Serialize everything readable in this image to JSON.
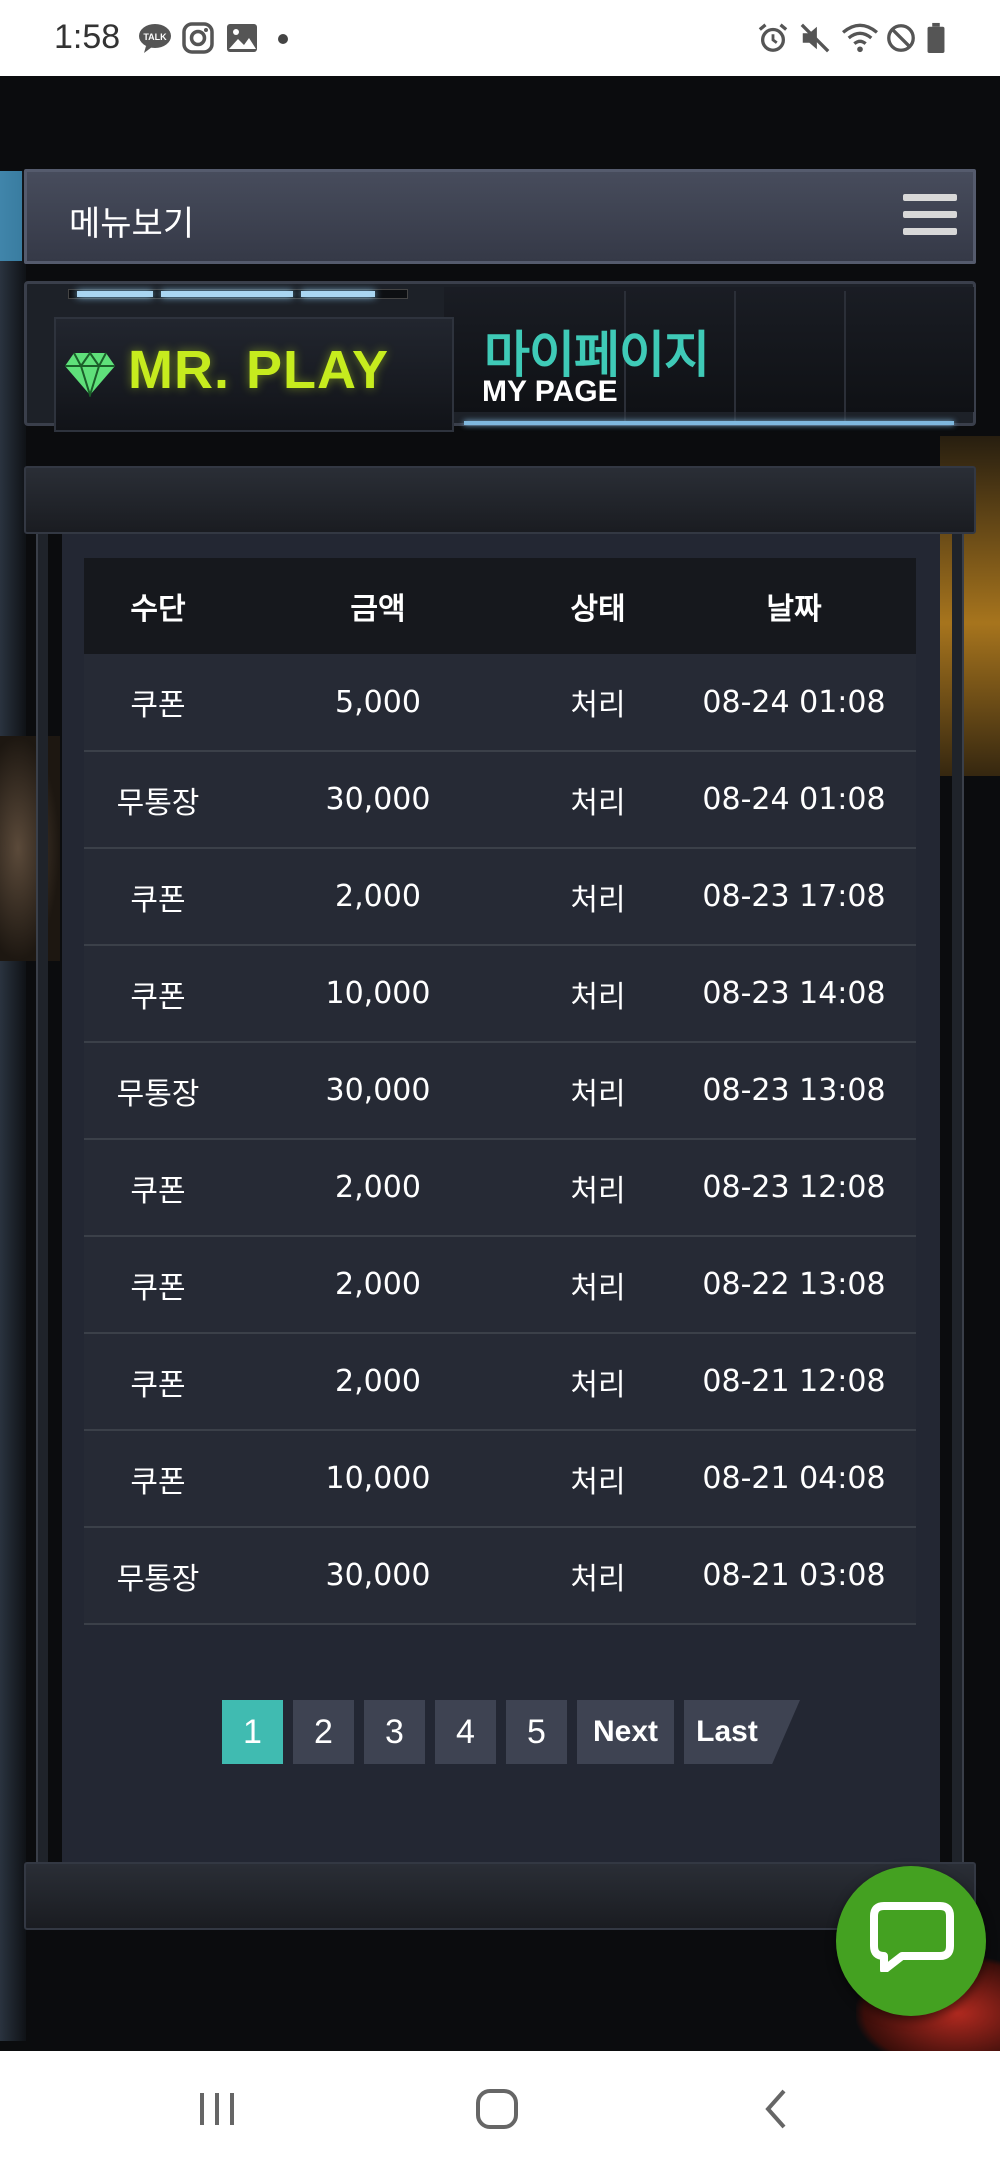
{
  "status_bar": {
    "time": "1:58",
    "left_icons": [
      "kakaotalk-icon",
      "instagram-icon",
      "gallery-icon"
    ],
    "right_icons": [
      "alarm-icon",
      "mute-icon",
      "wifi-icon",
      "dnd-icon",
      "battery-icon"
    ]
  },
  "menu": {
    "label": "메뉴보기"
  },
  "brand": {
    "logo_text": "MR. PLAY",
    "accent_color": "#c6ec1e"
  },
  "page_header": {
    "title_ko": "마이페이지",
    "title_en": "MY PAGE",
    "title_color": "#3fcab7"
  },
  "table": {
    "headers": [
      "수단",
      "금액",
      "상태",
      "날짜"
    ],
    "rows": [
      [
        "쿠폰",
        "5,000",
        "처리",
        "08-24 01:08"
      ],
      [
        "무통장",
        "30,000",
        "처리",
        "08-24 01:08"
      ],
      [
        "쿠폰",
        "2,000",
        "처리",
        "08-23 17:08"
      ],
      [
        "쿠폰",
        "10,000",
        "처리",
        "08-23 14:08"
      ],
      [
        "무통장",
        "30,000",
        "처리",
        "08-23 13:08"
      ],
      [
        "쿠폰",
        "2,000",
        "처리",
        "08-23 12:08"
      ],
      [
        "쿠폰",
        "2,000",
        "처리",
        "08-22 13:08"
      ],
      [
        "쿠폰",
        "2,000",
        "처리",
        "08-21 12:08"
      ],
      [
        "쿠폰",
        "10,000",
        "처리",
        "08-21 04:08"
      ],
      [
        "무통장",
        "30,000",
        "처리",
        "08-21 03:08"
      ]
    ]
  },
  "pagination": {
    "pages": [
      "1",
      "2",
      "3",
      "4",
      "5"
    ],
    "current": "1",
    "next_label": "Next",
    "last_label": "Last",
    "active_color": "#40bbb1"
  },
  "chat": {
    "icon": "chat-bubble-icon",
    "color": "#44a121"
  }
}
